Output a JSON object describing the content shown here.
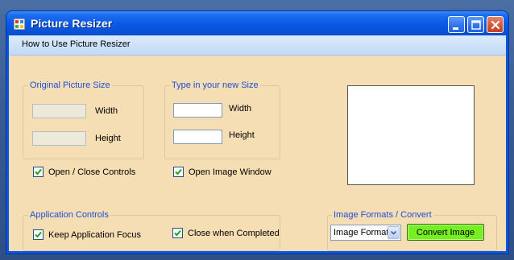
{
  "window": {
    "title": "Picture Resizer"
  },
  "menu": {
    "items": [
      "How to Use Picture Resizer"
    ]
  },
  "original_size": {
    "legend": "Original Picture Size",
    "width_label": "Width",
    "height_label": "Height",
    "width_value": "",
    "height_value": ""
  },
  "new_size": {
    "legend": "Type in your  new Size",
    "width_label": "Width",
    "height_label": "Height",
    "width_value": "",
    "height_value": ""
  },
  "checkboxes": {
    "open_close_controls": {
      "label": "Open / Close Controls",
      "checked": true
    },
    "open_image_window": {
      "label": "Open Image Window",
      "checked": true
    },
    "keep_app_focus": {
      "label": "Keep Application Focus",
      "checked": true
    },
    "close_when_completed": {
      "label": "Close when Completed",
      "checked": true
    }
  },
  "app_controls": {
    "legend": "Application Controls"
  },
  "formats": {
    "legend": "Image Formats / Convert",
    "select_value": "Image Format",
    "convert_label": "Convert Image"
  },
  "colors": {
    "title_bar": "#0a5ae6",
    "client_background": "#f5deb3",
    "legend_text": "#1f4dd9",
    "convert_button": "#77ee22"
  }
}
